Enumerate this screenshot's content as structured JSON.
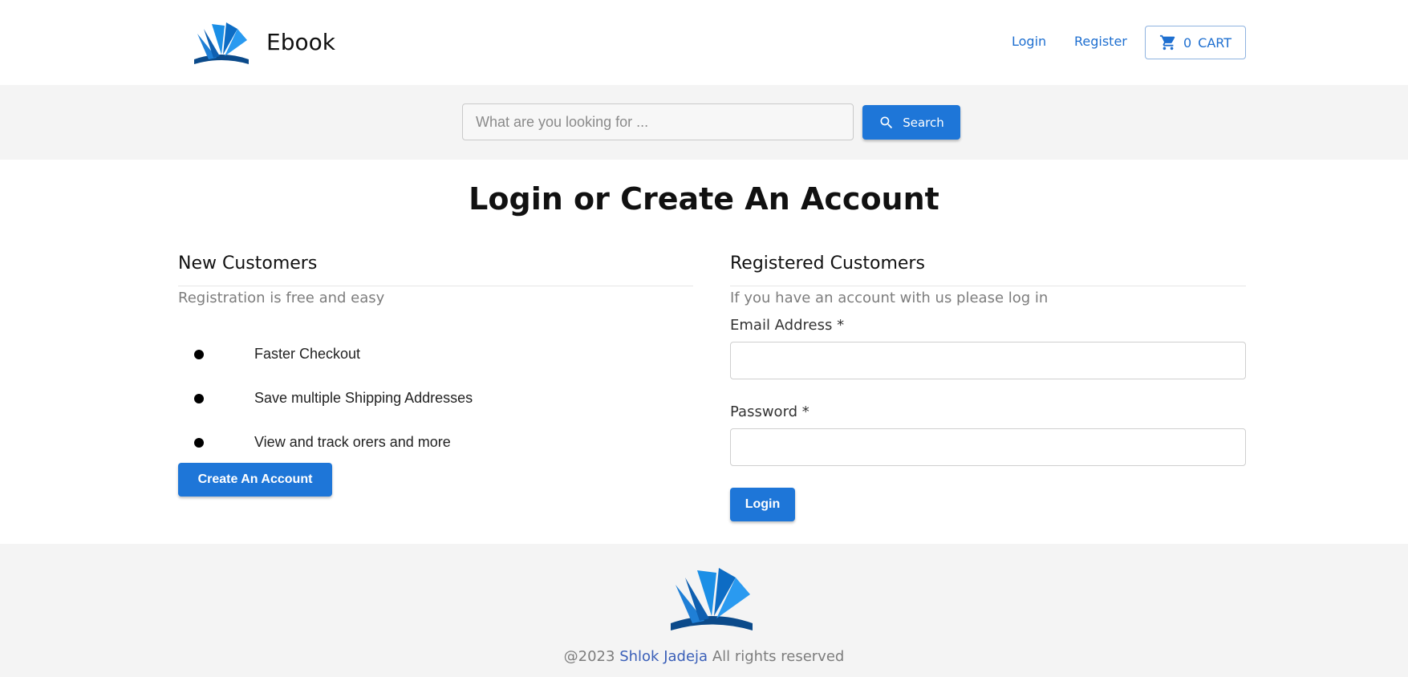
{
  "header": {
    "brand": "Ebook",
    "nav": {
      "login": "Login",
      "register": "Register"
    },
    "cart": {
      "count": "0",
      "label": "CART",
      "icon": "shopping-cart-icon"
    }
  },
  "search": {
    "placeholder": "What are you looking for ...",
    "button_label": "Search",
    "icon": "search-icon"
  },
  "main": {
    "title": "Login or Create An Account",
    "new_customers": {
      "heading": "New Customers",
      "subheading": "Registration is free and easy",
      "benefits": [
        "Faster Checkout",
        "Save multiple Shipping Addresses",
        "View and track orers and more"
      ],
      "button_label": "Create An Account"
    },
    "registered_customers": {
      "heading": "Registered Customers",
      "subheading": "If you have an account with us please log in",
      "email_label": "Email Address *",
      "email_value": "",
      "password_label": "Password *",
      "password_value": "",
      "button_label": "Login"
    }
  },
  "footer": {
    "copyright_prefix": "@2023",
    "author": "Shlok Jadeja",
    "copyright_suffix": "All rights reserved"
  },
  "colors": {
    "accent": "#1e76d8",
    "link": "#1e6fd0",
    "band_background": "#f4f4f4"
  }
}
